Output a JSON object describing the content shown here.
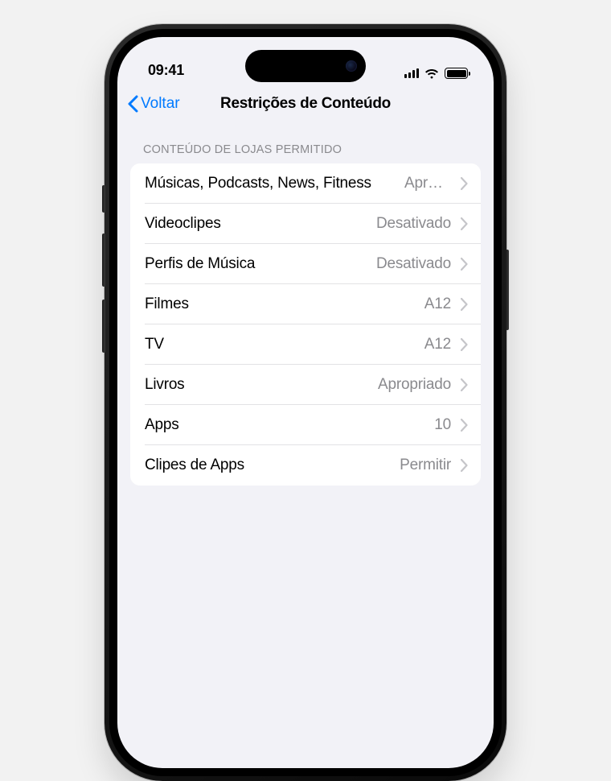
{
  "status": {
    "time": "09:41"
  },
  "nav": {
    "back_label": "Voltar",
    "title": "Restrições de Conteúdo"
  },
  "section": {
    "header": "CONTEÚDO DE LOJAS PERMITIDO"
  },
  "rows": [
    {
      "label": "Músicas, Podcasts, News, Fitness",
      "value": "Apropriado"
    },
    {
      "label": "Videoclipes",
      "value": "Desativado"
    },
    {
      "label": "Perfis de Música",
      "value": "Desativado"
    },
    {
      "label": "Filmes",
      "value": "A12"
    },
    {
      "label": "TV",
      "value": "A12"
    },
    {
      "label": "Livros",
      "value": "Apropriado"
    },
    {
      "label": "Apps",
      "value": "10"
    },
    {
      "label": "Clipes de Apps",
      "value": "Permitir"
    }
  ],
  "colors": {
    "accent": "#007aff",
    "bg": "#f2f2f7",
    "secondary_text": "#8a8a8e"
  }
}
